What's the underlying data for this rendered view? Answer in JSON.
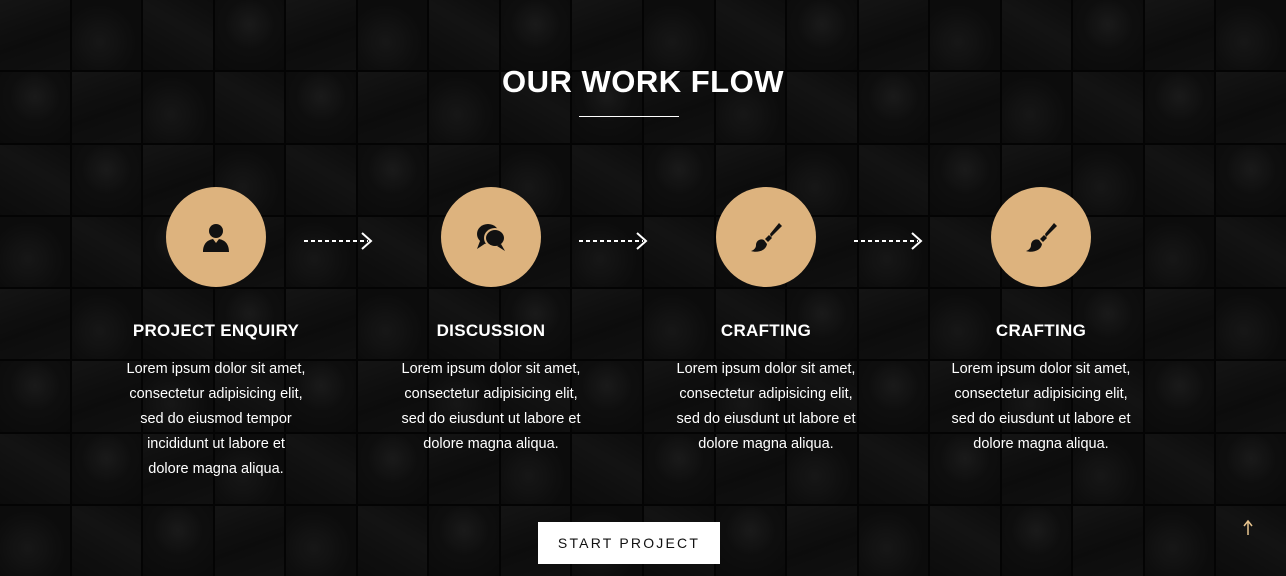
{
  "section": {
    "title": "OUR WORK FLOW"
  },
  "colors": {
    "accent": "#DDB37E",
    "icon": "#111111",
    "text": "#FFFFFF",
    "button_bg": "#FFFFFF"
  },
  "steps": [
    {
      "icon": "user-icon",
      "title": "PROJECT ENQUIRY",
      "text": "Lorem ipsum dolor sit amet, consectetur adipisicing elit, sed do eiusmod tempor incididunt ut labore et dolore magna aliqua."
    },
    {
      "icon": "chat-bubbles-icon",
      "title": "DISCUSSION",
      "text": "Lorem ipsum dolor sit amet, consectetur adipisicing elit, sed do eiusdunt ut labore et dolore magna aliqua."
    },
    {
      "icon": "paintbrush-icon",
      "title": "CRAFTING",
      "text": "Lorem ipsum dolor sit amet, consectetur adipisicing elit, sed do eiusdunt ut labore et dolore magna aliqua."
    },
    {
      "icon": "paintbrush-icon",
      "title": "CRAFTING",
      "text": "Lorem ipsum dolor sit amet, consectetur adipisicing elit, sed do eiusdunt ut labore et dolore magna aliqua."
    }
  ],
  "cta": {
    "label": "START PROJECT"
  },
  "scroll_top": {
    "icon": "arrow-up-icon"
  }
}
